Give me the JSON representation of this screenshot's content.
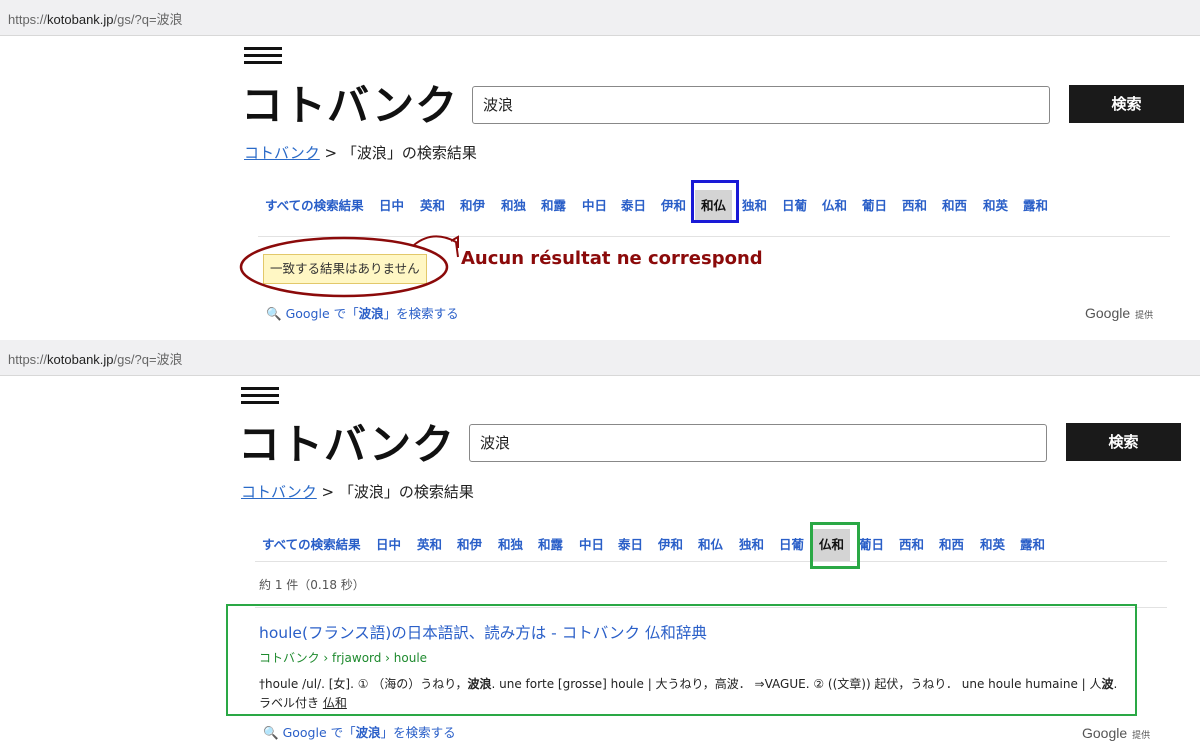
{
  "top": {
    "url": {
      "scheme": "https://",
      "host": "kotobank.jp",
      "path": "/gs/?q=波浪"
    },
    "logo": "コトバンク",
    "search_value": "波浪",
    "search_button": "検索",
    "breadcrumb": {
      "home": "コトバンク",
      "sep": ">",
      "current": "「波浪」の検索結果"
    },
    "tabs": [
      "すべての検索結果",
      "日中",
      "英和",
      "和伊",
      "和独",
      "和露",
      "中日",
      "泰日",
      "伊和",
      "和仏",
      "独和",
      "日葡",
      "仏和",
      "葡日",
      "西和",
      "和西",
      "和英",
      "露和"
    ],
    "selected_tab": "和仏",
    "no_results": "一致する結果はありません",
    "annotation": "Aucun résultat ne correspond",
    "google_link": {
      "pre": "Google で「",
      "term": "波浪",
      "post": "」を検索する"
    },
    "google_provided": {
      "brand": "Google",
      "label": "提供"
    }
  },
  "bottom": {
    "url": {
      "scheme": "https://",
      "host": "kotobank.jp",
      "path": "/gs/?q=波浪"
    },
    "logo": "コトバンク",
    "search_value": "波浪",
    "search_button": "検索",
    "breadcrumb": {
      "home": "コトバンク",
      "sep": ">",
      "current": "「波浪」の検索結果"
    },
    "tabs": [
      "すべての検索結果",
      "日中",
      "英和",
      "和伊",
      "和独",
      "和露",
      "中日",
      "泰日",
      "伊和",
      "和仏",
      "独和",
      "日葡",
      "仏和",
      "葡日",
      "西和",
      "和西",
      "和英",
      "露和"
    ],
    "selected_tab": "仏和",
    "count": "約 1 件（0.18 秒）",
    "result": {
      "title": "houle(フランス語)の日本語訳、読み方は - コトバンク 仏和辞典",
      "path": "コトバンク › frjaword › houle",
      "snippet_a": "†houle /ul/. [女]. ① （海の）うねり，",
      "snippet_bold1": "波浪",
      "snippet_b": ". une forte [grosse] houle | 大うねり，高波． ⇒VAGUE. ② ((文章)) 起伏，うねり． une houle humaine | 人",
      "snippet_bold2": "波",
      "snippet_c": ".",
      "label_prefix": "ラベル付き",
      "label_link": "仏和"
    },
    "google_link": {
      "pre": "Google で「",
      "term": "波浪",
      "post": "」を検索する"
    },
    "google_provided": {
      "brand": "Google",
      "label": "提供"
    }
  },
  "colors": {
    "blue_box": "#1a1ad6",
    "red_annotation": "#8b0a0a",
    "green_box": "#2aa845"
  }
}
